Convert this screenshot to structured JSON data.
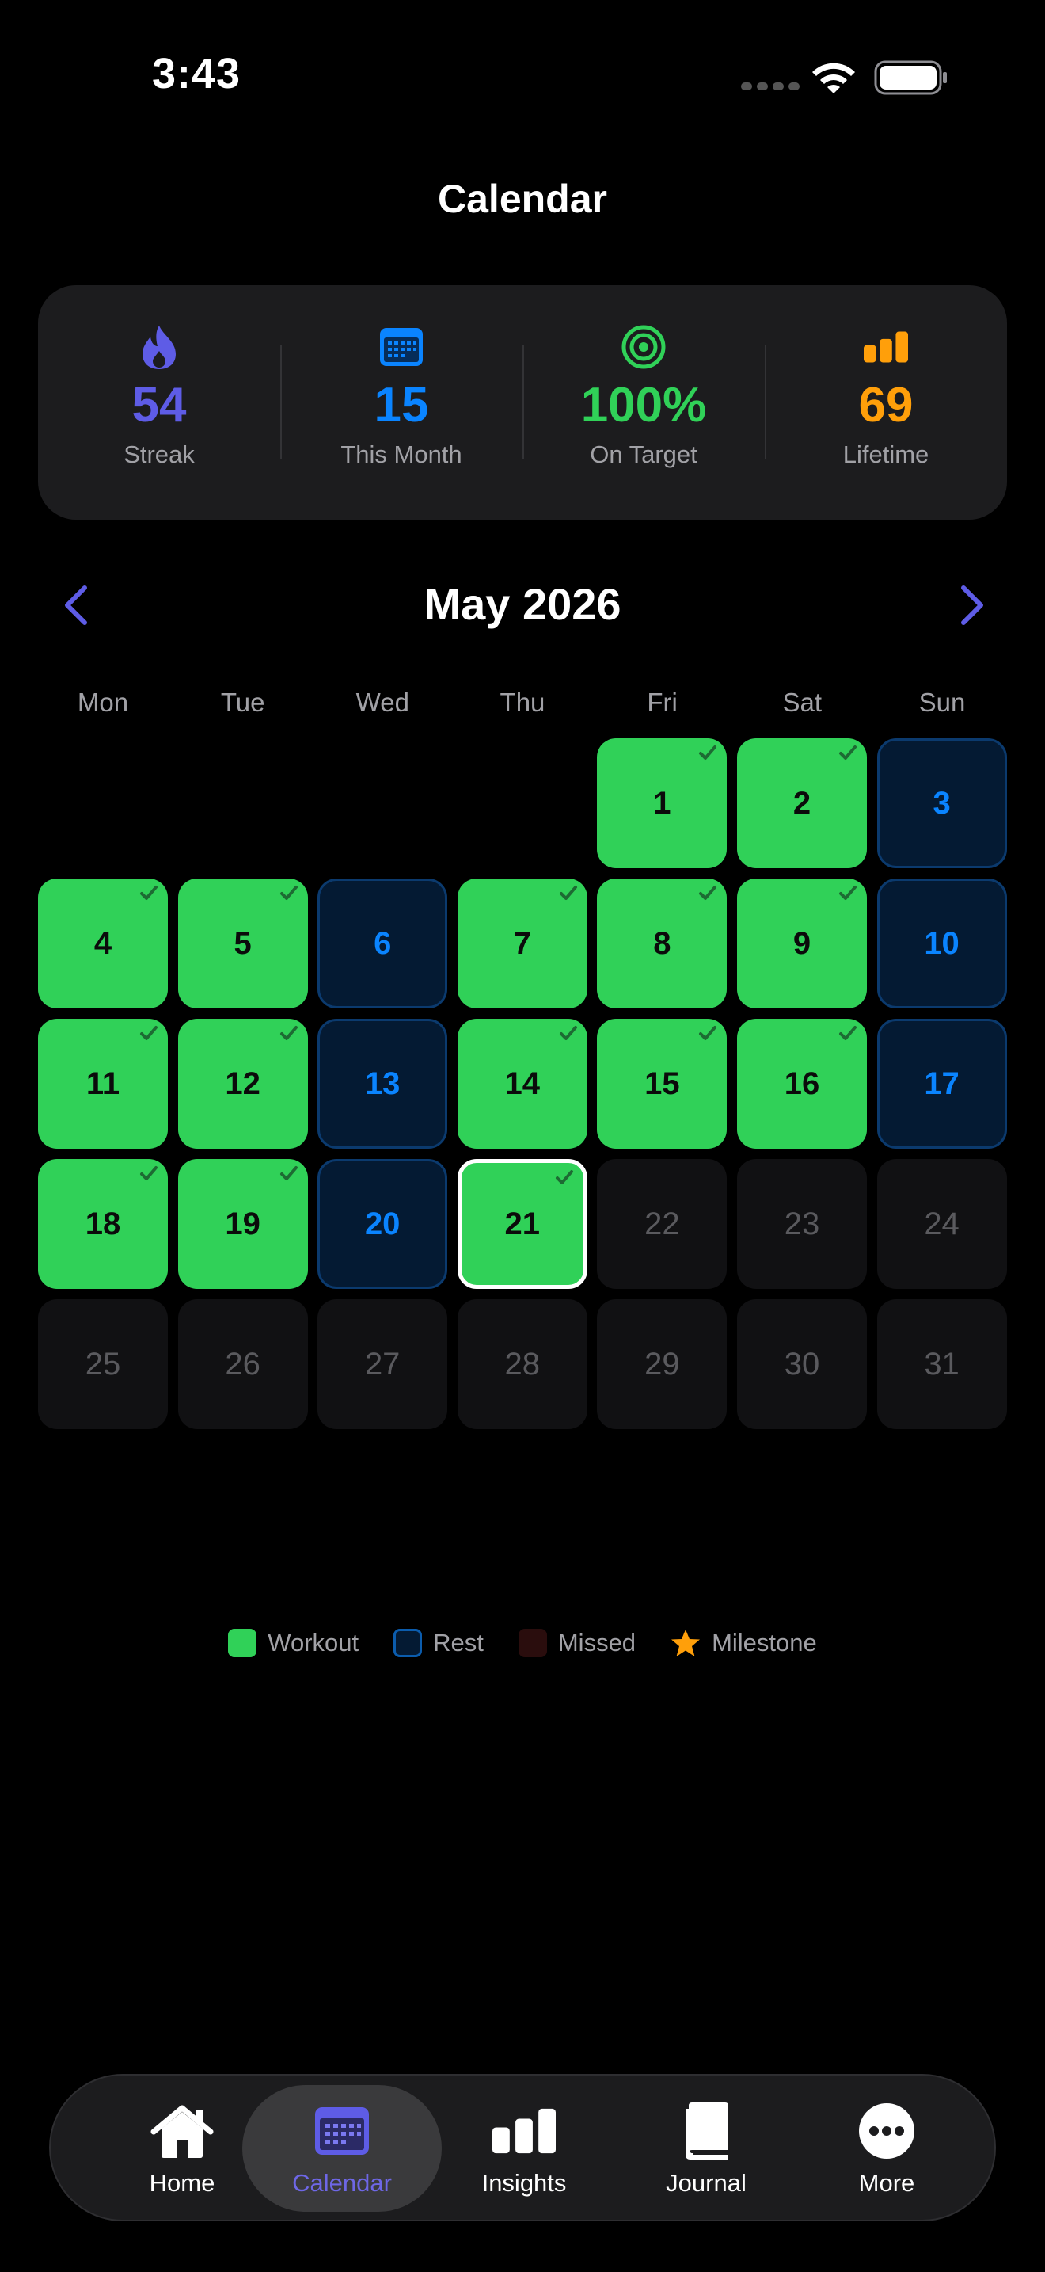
{
  "status_bar": {
    "time": "3:43"
  },
  "header": {
    "title": "Calendar"
  },
  "stats": [
    {
      "id": "streak",
      "icon": "flame-icon",
      "value": "54",
      "label": "Streak",
      "color": "#5e5ce6"
    },
    {
      "id": "month",
      "icon": "calendar-icon",
      "value": "15",
      "label": "This Month",
      "color": "#0a84ff"
    },
    {
      "id": "target",
      "icon": "target-icon",
      "value": "100%",
      "label": "On Target",
      "color": "#30d158"
    },
    {
      "id": "lifetime",
      "icon": "bar-chart-icon",
      "value": "69",
      "label": "Lifetime",
      "color": "#ff9f0a"
    }
  ],
  "calendar": {
    "month_label": "May 2026",
    "weekdays": [
      "Mon",
      "Tue",
      "Wed",
      "Thu",
      "Fri",
      "Sat",
      "Sun"
    ],
    "leading_empty": 4,
    "today": 21,
    "days": [
      {
        "day": "1",
        "status": "workout"
      },
      {
        "day": "2",
        "status": "workout"
      },
      {
        "day": "3",
        "status": "rest"
      },
      {
        "day": "4",
        "status": "workout"
      },
      {
        "day": "5",
        "status": "workout"
      },
      {
        "day": "6",
        "status": "rest"
      },
      {
        "day": "7",
        "status": "workout"
      },
      {
        "day": "8",
        "status": "workout"
      },
      {
        "day": "9",
        "status": "workout"
      },
      {
        "day": "10",
        "status": "rest"
      },
      {
        "day": "11",
        "status": "workout"
      },
      {
        "day": "12",
        "status": "workout"
      },
      {
        "day": "13",
        "status": "rest"
      },
      {
        "day": "14",
        "status": "workout"
      },
      {
        "day": "15",
        "status": "workout"
      },
      {
        "day": "16",
        "status": "workout"
      },
      {
        "day": "17",
        "status": "rest"
      },
      {
        "day": "18",
        "status": "workout"
      },
      {
        "day": "19",
        "status": "workout"
      },
      {
        "day": "20",
        "status": "rest"
      },
      {
        "day": "21",
        "status": "workout"
      },
      {
        "day": "22",
        "status": "future"
      },
      {
        "day": "23",
        "status": "future"
      },
      {
        "day": "24",
        "status": "future"
      },
      {
        "day": "25",
        "status": "future"
      },
      {
        "day": "26",
        "status": "future"
      },
      {
        "day": "27",
        "status": "future"
      },
      {
        "day": "28",
        "status": "future"
      },
      {
        "day": "29",
        "status": "future"
      },
      {
        "day": "30",
        "status": "future"
      },
      {
        "day": "31",
        "status": "future"
      }
    ]
  },
  "legend": [
    {
      "label": "Workout",
      "swatch": "workout"
    },
    {
      "label": "Rest",
      "swatch": "rest"
    },
    {
      "label": "Missed",
      "swatch": "missed"
    },
    {
      "label": "Milestone",
      "swatch": "star-icon"
    }
  ],
  "tabs": [
    {
      "id": "home",
      "label": "Home",
      "icon": "house-icon",
      "active": false
    },
    {
      "id": "calendar",
      "label": "Calendar",
      "icon": "calendar-icon",
      "active": true
    },
    {
      "id": "insights",
      "label": "Insights",
      "icon": "bar-chart-icon",
      "active": false
    },
    {
      "id": "journal",
      "label": "Journal",
      "icon": "book-icon",
      "active": false
    },
    {
      "id": "more",
      "label": "More",
      "icon": "ellipsis-icon",
      "active": false
    }
  ],
  "colors": {
    "workout": "#30d158",
    "rest_text": "#0a84ff",
    "accent": "#5e5ce6",
    "milestone": "#ff9f0a"
  }
}
